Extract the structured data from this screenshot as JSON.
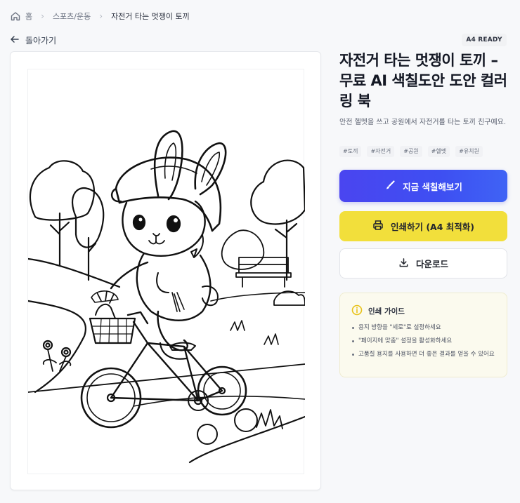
{
  "breadcrumb": {
    "home": "홈",
    "category": "스포츠/운동",
    "current": "자전거 타는 멋쟁이 토끼"
  },
  "back_label": "돌아가기",
  "badge": "A4 READY",
  "title": "자전거 타는 멋쟁이 토끼 – 무료 AI 색칠도안 도안 컬러링 북",
  "description": "안전 헬멧을 쓰고 공원에서 자전거를 타는 토끼 친구예요.",
  "tags": [
    "#토끼",
    "#자전거",
    "#공원",
    "#헬멧",
    "#유치원"
  ],
  "buttons": {
    "color_now": "지금 색칠해보기",
    "print": "인쇄하기 (A4 최적화)",
    "download": "다운로드"
  },
  "guide": {
    "title": "인쇄 가이드",
    "items": [
      "용지 방향을 \"세로\"로 설정하세요",
      "\"페이지에 맞춤\" 설정을 활성화하세요",
      "고품질 용지를 사용하면 더 좋은 결과를 얻을 수 있어요"
    ]
  },
  "icons": {
    "home": "home-icon",
    "back": "arrow-left-icon",
    "brush": "brush-icon",
    "printer": "printer-icon",
    "download": "download-icon",
    "info": "info-icon"
  },
  "colors": {
    "primary": "#4a45f0",
    "print": "#f2df3b",
    "guide_bg": "#fbfaee",
    "guide_icon": "#e8c21a"
  },
  "coloring_image": {
    "alt": "자전거 타는 멋쟁이 토끼"
  }
}
